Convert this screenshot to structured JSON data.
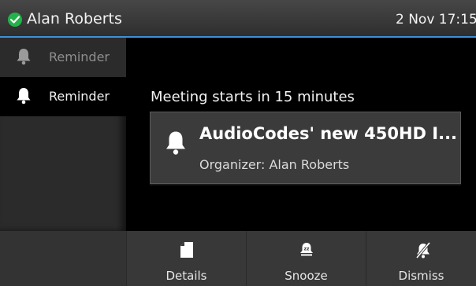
{
  "status_bar": {
    "user_name": "Alan Roberts",
    "clock": "2 Nov 17:15",
    "status": "available",
    "status_color": "#24b24b",
    "accent_color": "#3f8fd6"
  },
  "sidebar": {
    "items": [
      {
        "label": "Reminder",
        "icon": "bell-icon",
        "selected": false
      },
      {
        "label": "Reminder",
        "icon": "bell-icon",
        "selected": true
      }
    ]
  },
  "main": {
    "headline": "Meeting starts in 15 minutes",
    "card": {
      "icon": "bell-icon",
      "title": "AudioCodes' new 450HD I...",
      "organizer": "Organizer: Alan Roberts"
    }
  },
  "softkeys": [
    {
      "label": "",
      "icon": ""
    },
    {
      "label": "Details",
      "icon": "document-icon"
    },
    {
      "label": "Snooze",
      "icon": "snooze-bell-icon"
    },
    {
      "label": "Dismiss",
      "icon": "bell-off-icon"
    }
  ]
}
